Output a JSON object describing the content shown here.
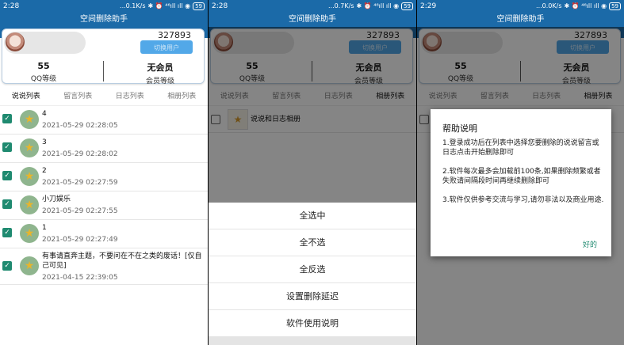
{
  "status_bars": [
    {
      "time": "2:28",
      "speed": "...0.1K/s",
      "battery": "59"
    },
    {
      "time": "2:28",
      "speed": "...0.7K/s",
      "battery": "59"
    },
    {
      "time": "2:29",
      "speed": "...0.0K/s",
      "battery": "59"
    }
  ],
  "status_icons": "✱ ⏰ ⁴⁶ıll ıll ◉",
  "app_title": "空间删除助手",
  "profile": {
    "qq_number": "327893",
    "switch_label": "切换用户",
    "qq_level_value": "55",
    "qq_level_label": "QQ等级",
    "vip_value": "无会员",
    "vip_label": "会员等级"
  },
  "tabs": [
    "说说列表",
    "留言列表",
    "日志列表",
    "相册列表"
  ],
  "shuoshuo_items": [
    {
      "title": "4",
      "date": "2021-05-29 02:28:05"
    },
    {
      "title": "3",
      "date": "2021-05-29 02:28:02"
    },
    {
      "title": "2",
      "date": "2021-05-29 02:27:59"
    },
    {
      "title": "小刀娱乐",
      "date": "2021-05-29 02:27:55"
    },
    {
      "title": "1",
      "date": "2021-05-29 02:27:49"
    },
    {
      "title": "有事请直奔主题，不要问在不在之类的废话！[仅自己可见]",
      "date": "2021-04-15 22:39:05"
    }
  ],
  "album_item": "说说和日志相册",
  "menu": [
    "全选中",
    "全不选",
    "全反选",
    "设置删除延迟",
    "软件使用说明"
  ],
  "help_dialog": {
    "title": "帮助说明",
    "p1": "1.登录成功后在列表中选择您要删除的说说留言或日志点击开始删除即可",
    "p2": "2.软件每次最多会加载前100条,如果删除频繁或者失败请间隔段时间再继续删除即可",
    "p3": "3.软件仅供参考交流与学习,请勿非法以及商业用途.",
    "ok": "好的"
  }
}
